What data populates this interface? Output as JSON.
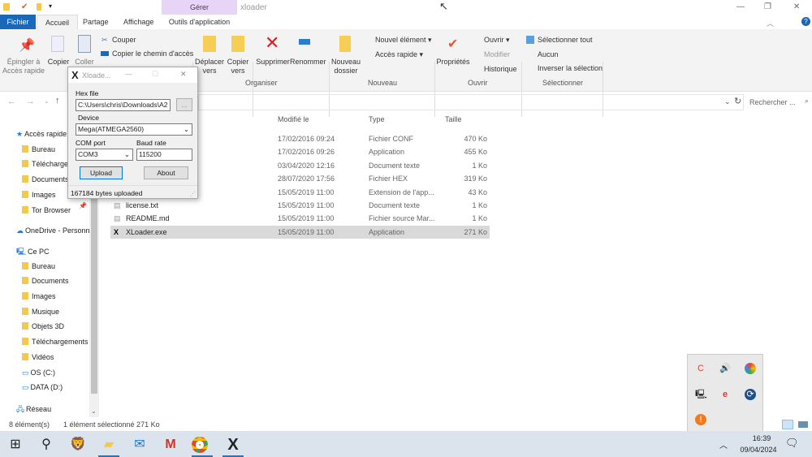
{
  "window": {
    "title": "xloader",
    "context_tab": "Gérer"
  },
  "tabs": [
    "Fichier",
    "Accueil",
    "Partage",
    "Affichage",
    "Outils d'application"
  ],
  "ribbon": {
    "pin": "Épingler à Accès rapide",
    "copy": "Copier",
    "paste": "Coller",
    "cut": "Couper",
    "copy_path": "Copier le chemin d'accès",
    "move": "Déplacer vers",
    "copy_to": "Copier vers",
    "delete": "Supprimer",
    "rename": "Renommer",
    "organise": "Organiser",
    "new_folder": "Nouveau dossier",
    "new_item": "Nouvel élément",
    "quick_access": "Accès rapide",
    "new_group": "Nouveau",
    "properties": "Propriétés",
    "open": "Ouvrir",
    "edit": "Modifier",
    "history": "Historique",
    "open_group": "Ouvrir",
    "select_all": "Sélectionner tout",
    "select_none": "Aucun",
    "invert": "Inverser la sélection",
    "select_group": "Sélectionner"
  },
  "search": {
    "placeholder": "Rechercher ..."
  },
  "columns": [
    "Modifié le",
    "Type",
    "Taille"
  ],
  "files": [
    {
      "name": "",
      "date": "17/02/2016 09:24",
      "type": "Fichier CONF",
      "size": "470 Ko"
    },
    {
      "name": "",
      "date": "17/02/2016 09:26",
      "type": "Application",
      "size": "455 Ko"
    },
    {
      "name": "",
      "date": "03/04/2020 12:16",
      "type": "Document texte",
      "size": "1 Ko"
    },
    {
      "name": "",
      "date": "28/07/2020 17:56",
      "type": "Fichier HEX",
      "size": "319 Ko"
    },
    {
      "name": "",
      "date": "15/05/2019 11:00",
      "type": "Extension de l'app...",
      "size": "43 Ko"
    },
    {
      "name": "license.txt",
      "date": "15/05/2019 11:00",
      "type": "Document texte",
      "size": "1 Ko"
    },
    {
      "name": "README.md",
      "date": "15/05/2019 11:00",
      "type": "Fichier source Mar...",
      "size": "1 Ko"
    },
    {
      "name": "XLoader.exe",
      "date": "15/05/2019 11:00",
      "type": "Application",
      "size": "271 Ko"
    }
  ],
  "sidebar": [
    "Accès rapide",
    "Bureau",
    "Téléchargements",
    "Documents",
    "Images",
    "Tor Browser",
    "OneDrive - Personnel",
    "Ce PC",
    "Bureau",
    "Documents",
    "Images",
    "Musique",
    "Objets 3D",
    "Téléchargements",
    "Vidéos",
    "OS (C:)",
    "DATA (D:)",
    "Réseau"
  ],
  "status": {
    "count": "8 élément(s)",
    "selection": "1 élément sélectionné  271 Ko"
  },
  "dialog": {
    "title": "Xloade...",
    "hex_label": "Hex file",
    "hex_value": "C:\\Users\\chris\\Downloads\\A2",
    "browse": "...",
    "device_label": "Device",
    "device": "Mega(ATMEGA2560)",
    "com_label": "COM port",
    "com": "COM3",
    "baud_label": "Baud rate",
    "baud": "115200",
    "upload": "Upload",
    "about": "About",
    "status": "167184 bytes uploaded"
  },
  "clock": {
    "time": "16:39",
    "date": "09/04/2024"
  }
}
